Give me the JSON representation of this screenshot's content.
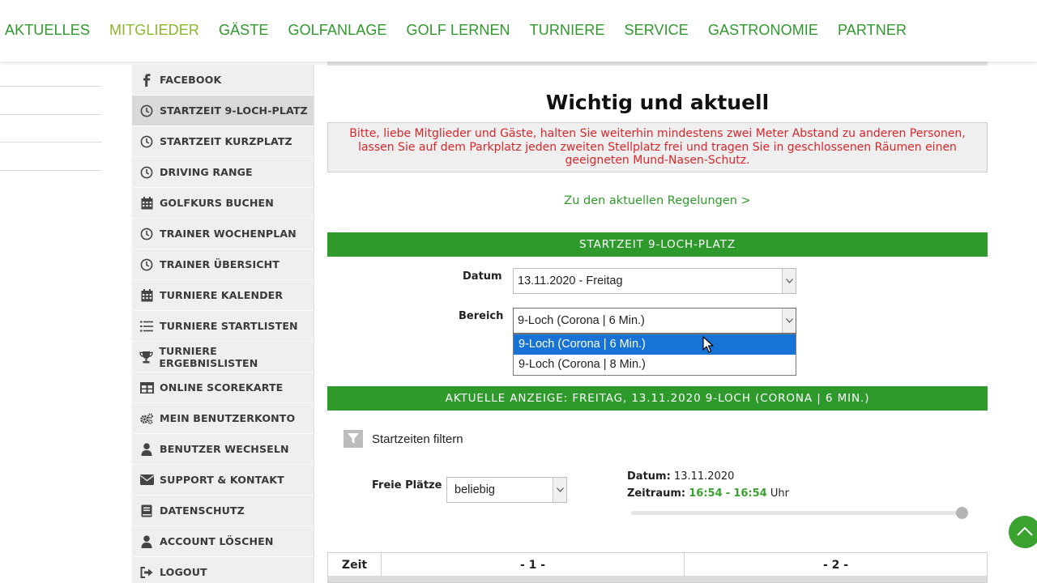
{
  "nav": {
    "items": [
      "AKTUELLES",
      "MITGLIEDER",
      "GÄSTE",
      "GOLFANLAGE",
      "GOLF LERNEN",
      "TURNIERE",
      "SERVICE",
      "GASTRONOMIE",
      "PARTNER"
    ],
    "active": "MITGLIEDER"
  },
  "sidebar": {
    "items": [
      {
        "label": "FACEBOOK",
        "icon": "facebook-icon"
      },
      {
        "label": "STARTZEIT 9-LOCH-PLATZ",
        "icon": "clock-icon",
        "active": true
      },
      {
        "label": "STARTZEIT KURZPLATZ",
        "icon": "clock-icon"
      },
      {
        "label": "DRIVING RANGE",
        "icon": "clock-icon"
      },
      {
        "label": "GOLFKURS BUCHEN",
        "icon": "calendar-icon"
      },
      {
        "label": "TRAINER WOCHENPLAN",
        "icon": "clock-icon"
      },
      {
        "label": "TRAINER ÜBERSICHT",
        "icon": "clock-icon"
      },
      {
        "label": "TURNIERE KALENDER",
        "icon": "calendar-icon"
      },
      {
        "label": "TURNIERE STARTLISTEN",
        "icon": "list-icon"
      },
      {
        "label": "TURNIERE ERGEBNISLISTEN",
        "icon": "trophy-icon"
      },
      {
        "label": "ONLINE SCOREKARTE",
        "icon": "table-icon"
      },
      {
        "label": "MEIN BENUTZERKONTO",
        "icon": "gears-icon"
      },
      {
        "label": "BENUTZER WECHSELN",
        "icon": "user-icon"
      },
      {
        "label": "SUPPORT & KONTAKT",
        "icon": "envelope-icon"
      },
      {
        "label": "DATENSCHUTZ",
        "icon": "book-icon"
      },
      {
        "label": "ACCOUNT LÖSCHEN",
        "icon": "user-icon"
      },
      {
        "label": "LOGOUT",
        "icon": "logout-icon"
      }
    ]
  },
  "main": {
    "title": "Wichtig und aktuell",
    "notice_lines": [
      "Bitte, liebe Mitglieder und Gäste, halten Sie weiterhin mindestens zwei Meter Abstand zu anderen Personen,",
      "lassen Sie auf dem Parkplatz jeden zweiten Stellplatz frei und tragen Sie in geschlossenen Räumen einen",
      "geeigneten Mund-Nasen-Schutz."
    ],
    "regel_link": "Zu den aktuellen Regelungen >",
    "section_title": "STARTZEIT 9-LOCH-PLATZ",
    "datum_label": "Datum",
    "datum_value": "13.11.2020 - Freitag",
    "bereich_label": "Bereich",
    "bereich_value": "9-Loch (Corona | 6 Min.)",
    "bereich_options": [
      "9-Loch (Corona | 6 Min.)",
      "9-Loch (Corona | 8 Min.)"
    ],
    "current_display": "AKTUELLE ANZEIGE: FREITAG, 13.11.2020 9-LOCH (CORONA | 6 MIN.)",
    "filter_label": "Startzeiten filtern",
    "freie_label": "Freie Plätze",
    "freie_value": "beliebig",
    "info": {
      "datum_label": "Datum:",
      "datum_value": "13.11.2020",
      "zeitraum_label": "Zeitraum:",
      "zeit_from": "16:54",
      "zeit_sep": "-",
      "zeit_to": "16:54",
      "zeit_unit": "Uhr"
    },
    "table_headers": [
      "Zeit",
      "- 1 -",
      "- 2 -"
    ]
  },
  "colors": {
    "accent": "#2e9a2c",
    "notice": "#d9262b",
    "select_highlight": "#1873d6"
  }
}
